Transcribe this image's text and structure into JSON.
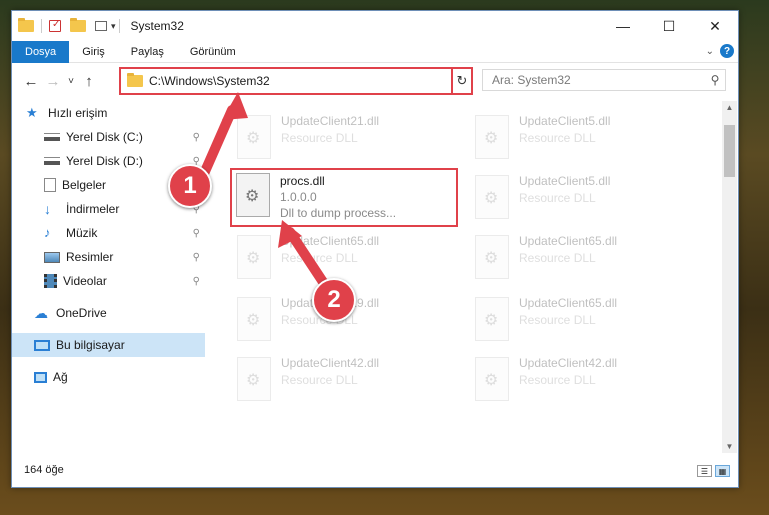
{
  "window": {
    "title": "System32",
    "controls": {
      "minimize": "—",
      "maximize": "☐",
      "close": "✕"
    }
  },
  "ribbon": {
    "tabs": [
      "Dosya",
      "Giriş",
      "Paylaş",
      "Görünüm"
    ],
    "active_tab": "Dosya",
    "help": "?"
  },
  "nav": {
    "back": "←",
    "forward": "→",
    "recent": "˅",
    "up": "↑"
  },
  "address": {
    "path": "C:\\Windows\\System32",
    "dropdown": "⌄",
    "refresh": "↻"
  },
  "search": {
    "placeholder": "Ara: System32",
    "icon": "search-icon"
  },
  "sidebar": {
    "items": [
      {
        "label": "Hızlı erişim",
        "icon": "star-icon",
        "pinned": false
      },
      {
        "label": "Yerel Disk (C:)",
        "icon": "drive-icon",
        "pinned": true
      },
      {
        "label": "Yerel Disk (D:)",
        "icon": "drive-icon",
        "pinned": true
      },
      {
        "label": "Belgeler",
        "icon": "documents-icon",
        "pinned": true
      },
      {
        "label": "İndirmeler",
        "icon": "downloads-icon",
        "pinned": true
      },
      {
        "label": "Müzik",
        "icon": "music-icon",
        "pinned": true
      },
      {
        "label": "Resimler",
        "icon": "pictures-icon",
        "pinned": true
      },
      {
        "label": "Videolar",
        "icon": "videos-icon",
        "pinned": true
      },
      {
        "label": "OneDrive",
        "icon": "cloud-icon",
        "pinned": false
      },
      {
        "label": "Bu bilgisayar",
        "icon": "computer-icon",
        "pinned": false
      },
      {
        "label": "Ağ",
        "icon": "network-icon",
        "pinned": false
      }
    ],
    "pin_glyph": "📌"
  },
  "files": {
    "ghost_items": [
      {
        "name": "UpdateClient21.dll",
        "type": "Resource DLL"
      },
      {
        "name": "UpdateClient5.dll",
        "type": "Resource DLL"
      },
      {
        "name": "UpdateClient5.dll",
        "type": "Resource DLL"
      },
      {
        "name": "UpdateClient65.dll",
        "type": "Resource DLL"
      },
      {
        "name": "UpdateClient65.dll",
        "type": "Resource DLL"
      },
      {
        "name": "UpdateClient19.dll",
        "type": "Resource DLL"
      },
      {
        "name": "UpdateClient65.dll",
        "type": "Resource DLL"
      },
      {
        "name": "UpdateClient42.dll",
        "type": "Resource DLL"
      },
      {
        "name": "UpdateClient42.dll",
        "type": "Resource DLL"
      }
    ],
    "highlighted": {
      "name": "procs.dll",
      "version": "1.0.0.0",
      "description": "Dll to dump process..."
    }
  },
  "status": {
    "count": "164 öğe"
  },
  "annotations": {
    "step1": "1",
    "step2": "2",
    "accent": "#e0414a"
  }
}
